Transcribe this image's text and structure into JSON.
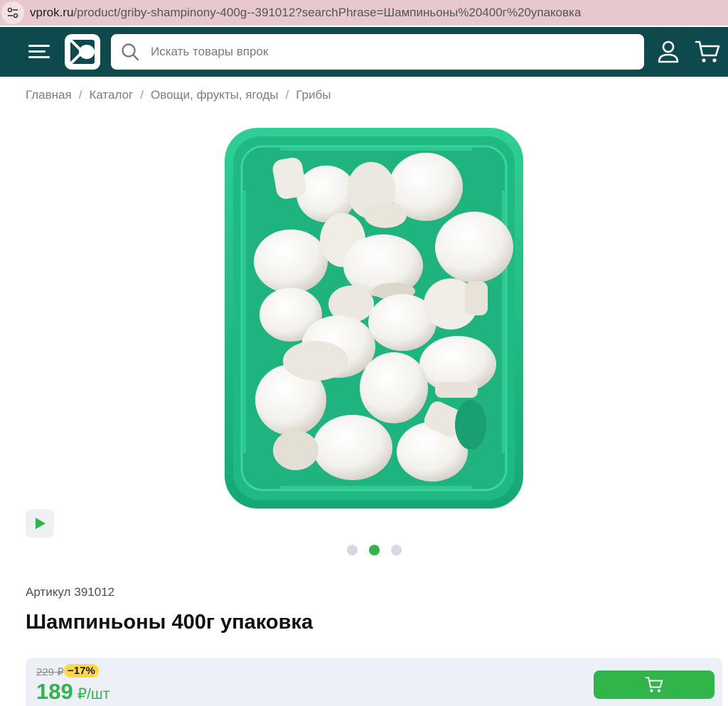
{
  "browser": {
    "url_domain": "vprok.ru",
    "url_path": "/product/griby-shampinony-400g--391012?searchPhrase=Шампиньоны%20400г%20упаковка"
  },
  "header": {
    "search_placeholder": "Искать товары впрок",
    "brand_color": "#0e4a4d"
  },
  "breadcrumb": [
    {
      "label": "Главная"
    },
    {
      "label": "Каталог"
    },
    {
      "label": "Овощи, фрукты, ягоды"
    },
    {
      "label": "Грибы"
    }
  ],
  "breadcrumb_separator": "/",
  "gallery": {
    "image_subject": "mushrooms-in-green-tray",
    "slide_count": 3,
    "active_slide": 2
  },
  "product": {
    "sku_label": "Артикул",
    "sku_value": "391012",
    "title": "Шампиньоны 400г упаковка"
  },
  "price": {
    "old_price": "229 ₽",
    "discount": "−17%",
    "current_amount": "189",
    "unit": "₽/шт",
    "accent_color": "#31b54a"
  }
}
